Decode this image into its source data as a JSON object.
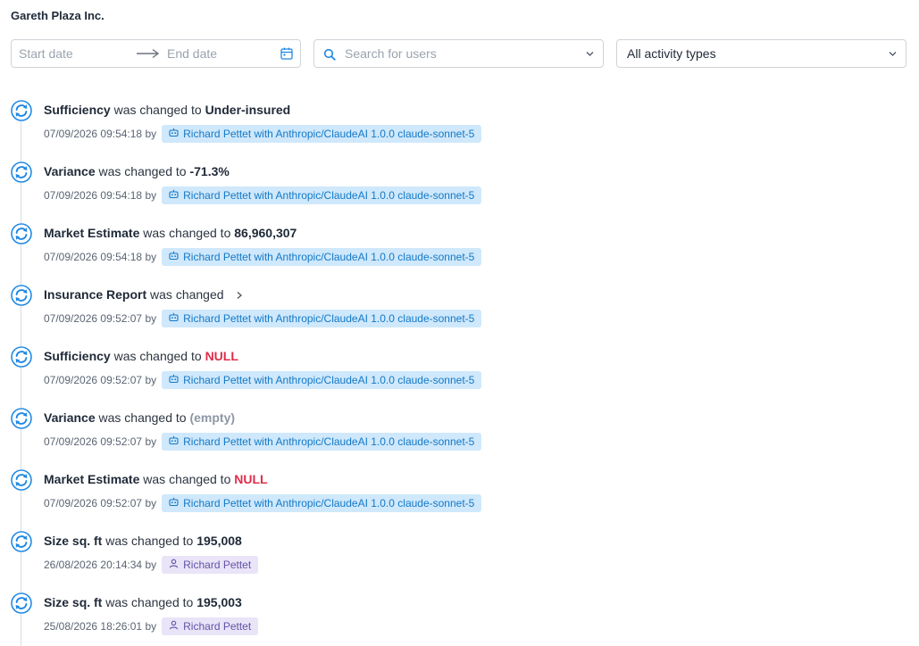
{
  "company": "Gareth Plaza Inc.",
  "filters": {
    "start_placeholder": "Start date",
    "end_placeholder": "End date",
    "user_search_placeholder": "Search for users",
    "activity_type": "All activity types"
  },
  "colors": {
    "accent": "#1e88e5",
    "null_value": "#e02d4b",
    "ai_badge_bg": "#cfe8fb",
    "person_badge_bg": "#e9e4f7"
  },
  "entries": [
    {
      "field": "Sufficiency",
      "action": "was changed to",
      "value": "Under-insured",
      "value_style": "normal",
      "timestamp": "07/09/2026 09:54:18",
      "by": "by",
      "user": "Richard Pettet with Anthropic/ClaudeAI 1.0.0 claude-sonnet-5",
      "user_type": "ai-icon"
    },
    {
      "field": "Variance",
      "action": "was changed to",
      "value": "-71.3%",
      "value_style": "normal",
      "timestamp": "07/09/2026 09:54:18",
      "by": "by",
      "user": "Richard Pettet with Anthropic/ClaudeAI 1.0.0 claude-sonnet-5",
      "user_type": "ai-icon"
    },
    {
      "field": "Market Estimate",
      "action": "was changed to",
      "value": "86,960,307",
      "value_style": "normal",
      "timestamp": "07/09/2026 09:54:18",
      "by": "by",
      "user": "Richard Pettet with Anthropic/ClaudeAI 1.0.0 claude-sonnet-5",
      "user_type": "ai-icon"
    },
    {
      "field": "Insurance Report",
      "action": "was changed",
      "value": "",
      "value_style": "expand",
      "timestamp": "07/09/2026 09:52:07",
      "by": "by",
      "user": "Richard Pettet with Anthropic/ClaudeAI 1.0.0 claude-sonnet-5",
      "user_type": "ai-icon"
    },
    {
      "field": "Sufficiency",
      "action": "was changed to",
      "value": "NULL",
      "value_style": "null",
      "timestamp": "07/09/2026 09:52:07",
      "by": "by",
      "user": "Richard Pettet with Anthropic/ClaudeAI 1.0.0 claude-sonnet-5",
      "user_type": "ai-icon"
    },
    {
      "field": "Variance",
      "action": "was changed to",
      "value": "(empty)",
      "value_style": "empty",
      "timestamp": "07/09/2026 09:52:07",
      "by": "by",
      "user": "Richard Pettet with Anthropic/ClaudeAI 1.0.0 claude-sonnet-5",
      "user_type": "ai-icon"
    },
    {
      "field": "Market Estimate",
      "action": "was changed to",
      "value": "NULL",
      "value_style": "null",
      "timestamp": "07/09/2026 09:52:07",
      "by": "by",
      "user": "Richard Pettet with Anthropic/ClaudeAI 1.0.0 claude-sonnet-5",
      "user_type": "ai-icon"
    },
    {
      "field": "Size sq. ft",
      "action": "was changed to",
      "value": "195,008",
      "value_style": "normal",
      "timestamp": "26/08/2026 20:14:34",
      "by": "by",
      "user": "Richard Pettet",
      "user_type": "person-icon"
    },
    {
      "field": "Size sq. ft",
      "action": "was changed to",
      "value": "195,003",
      "value_style": "normal",
      "timestamp": "25/08/2026 18:26:01",
      "by": "by",
      "user": "Richard Pettet",
      "user_type": "person-icon"
    }
  ]
}
